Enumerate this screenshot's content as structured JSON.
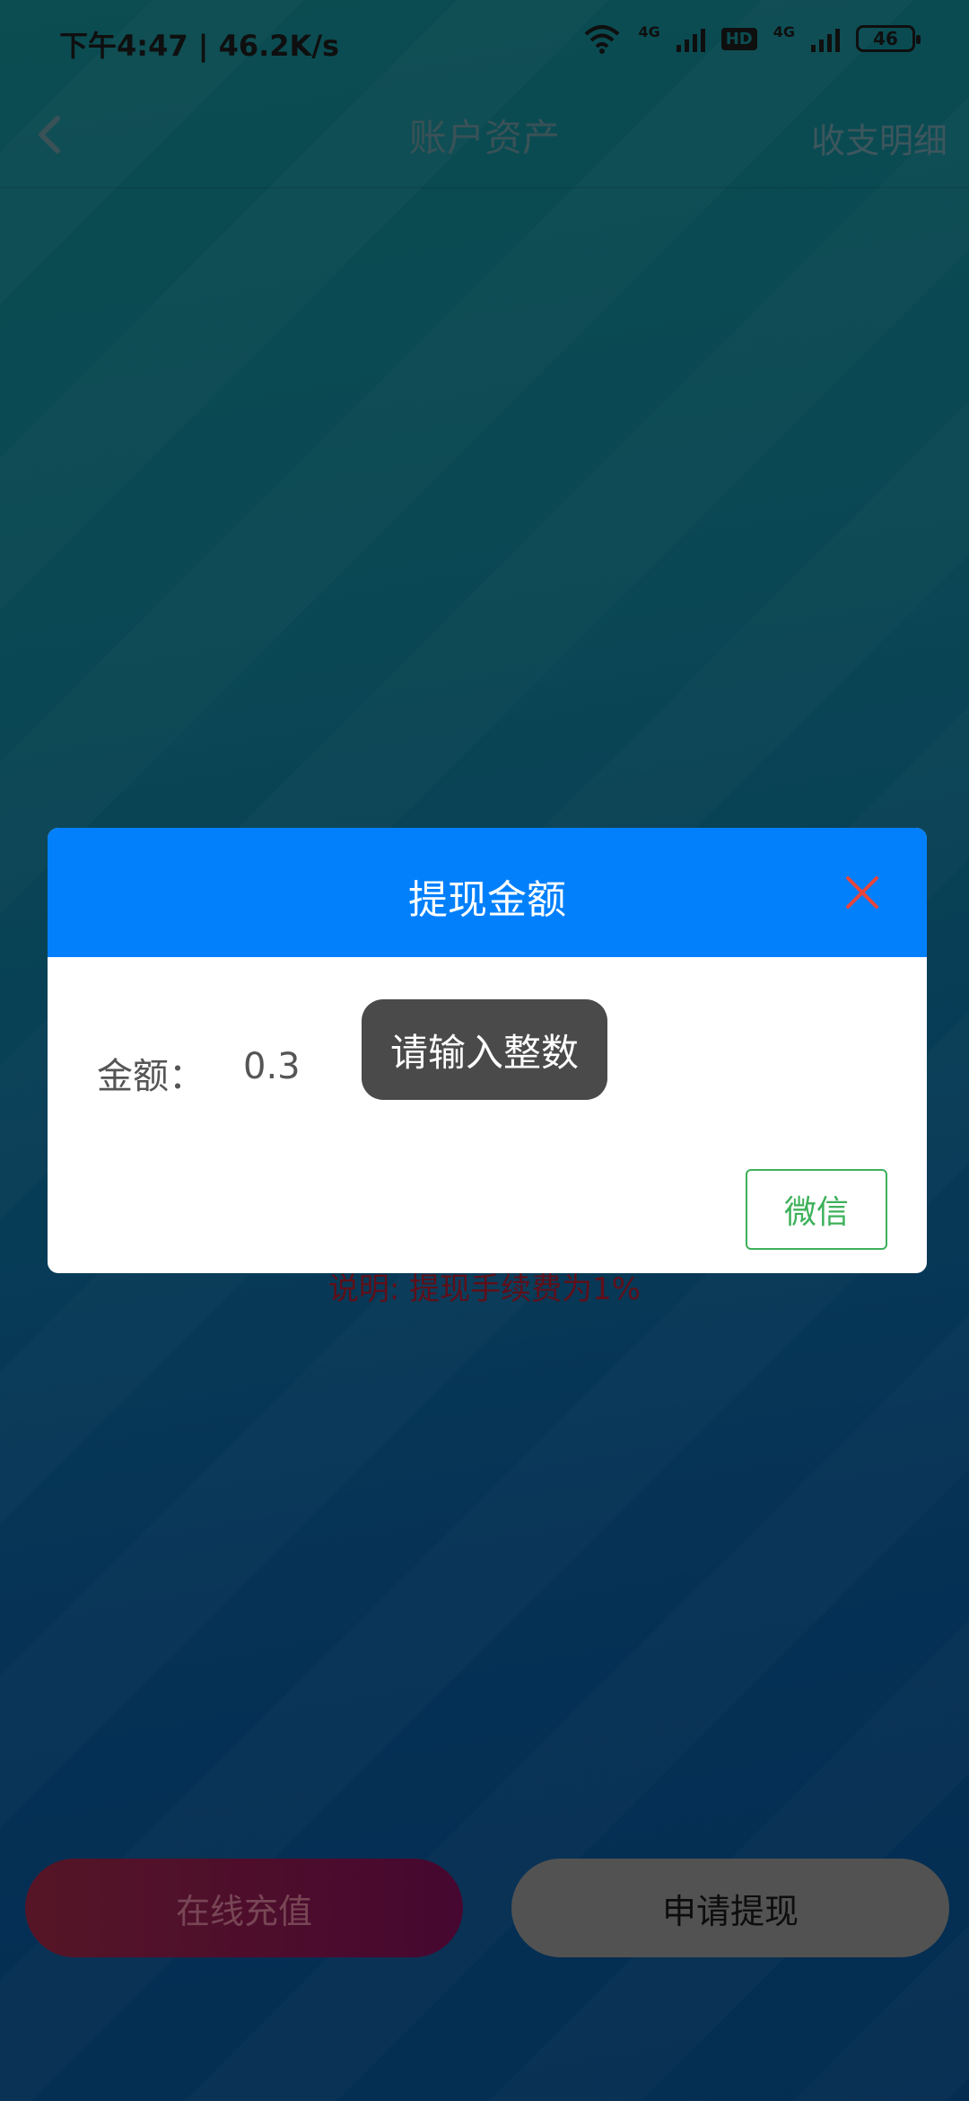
{
  "status_bar": {
    "time": "下午4:47 | 46.2K/s",
    "network_1": "4G",
    "hd": "HD",
    "network_2": "4G",
    "battery": "46"
  },
  "nav": {
    "title": "账户资产",
    "right_link": "收支明细"
  },
  "note": "说明: 提现手续费为1%",
  "buttons": {
    "recharge": "在线充值",
    "withdraw": "申请提现"
  },
  "dialog": {
    "title": "提现金额",
    "amount_label": "金额：",
    "amount_value": "0.3",
    "wechat_label": "微信"
  },
  "toast": "请输入整数",
  "colors": {
    "dialog_header": "#0280fc",
    "close_icon": "#e8453c",
    "wechat_green": "#3db15a",
    "note_red": "#7a1420"
  }
}
